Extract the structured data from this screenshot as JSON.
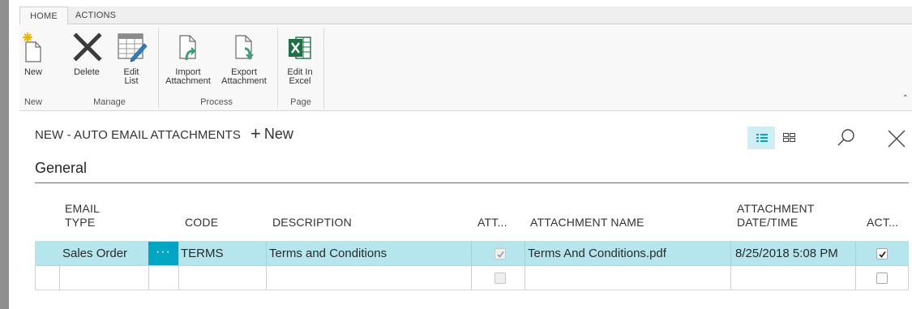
{
  "ribbon": {
    "tabs": [
      {
        "label": "HOME",
        "active": true
      },
      {
        "label": "ACTIONS",
        "active": false
      }
    ],
    "buttons": {
      "new": "New",
      "delete": "Delete",
      "edit_list": "Edit\nList",
      "import_attachment": "Import\nAttachment",
      "export_attachment": "Export\nAttachment",
      "edit_in_excel": "Edit In\nExcel"
    },
    "groups": {
      "new": "New",
      "manage": "Manage",
      "process": "Process",
      "page": "Page"
    }
  },
  "page": {
    "title": "NEW - AUTO EMAIL ATTACHMENTS",
    "new_action": "New",
    "section": "General"
  },
  "grid": {
    "headers": {
      "email_type": "EMAIL\nTYPE",
      "code": "CODE",
      "description": "DESCRIPTION",
      "att": "ATT...",
      "attachment_name": "ATTACHMENT NAME",
      "attachment_datetime": "ATTACHMENT\nDATE/TIME",
      "act": "ACT..."
    },
    "rows": [
      {
        "email_type": "Sales Order",
        "code": "TERMS",
        "description": "Terms and Conditions",
        "att": true,
        "attachment_name": "Terms And Conditions.pdf",
        "attachment_datetime": "8/25/2018 5:08 PM",
        "act": true
      },
      {
        "email_type": "",
        "code": "",
        "description": "",
        "att": false,
        "attachment_name": "",
        "attachment_datetime": "",
        "act": false
      }
    ]
  },
  "colors": {
    "accent": "#00a6c4",
    "selected_row": "#b5e6ee",
    "excel_green": "#1e7145"
  }
}
